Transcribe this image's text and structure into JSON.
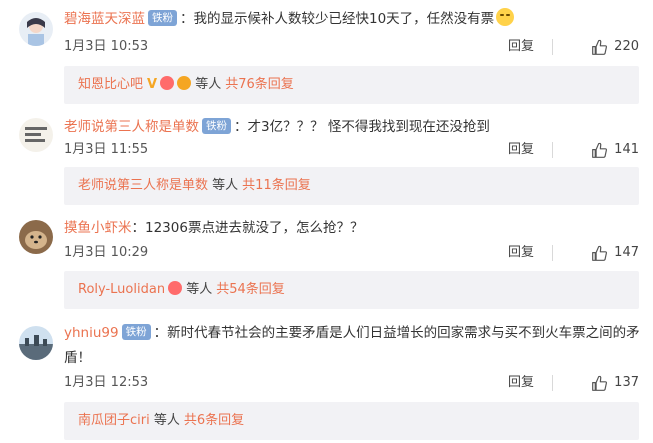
{
  "comments": [
    {
      "username": "碧海蓝天深蓝",
      "badge": "铁粉",
      "text": "：我的显示候补人数较少已经快10天了，任然没有票",
      "date": "1月3日 10:53",
      "reply_label": "回复",
      "likes": "220",
      "replies": {
        "name": "知恩比心吧",
        "middle": "等人",
        "total": "共76条回复"
      }
    },
    {
      "username": "老师说第三人称是单数",
      "badge": "铁粉",
      "text": "：才3亿？？？ 怪不得我找到现在还没抢到",
      "date": "1月3日 11:55",
      "reply_label": "回复",
      "likes": "141",
      "replies": {
        "name": "老师说第三人称是单数",
        "middle": "等人",
        "total": "共11条回复"
      }
    },
    {
      "username": "摸鱼小虾米",
      "text": "：12306票点进去就没了，怎么抢？？",
      "date": "1月3日 10:29",
      "reply_label": "回复",
      "likes": "147",
      "replies": {
        "name": "Roly-Luolidan",
        "middle": "等人",
        "total": "共54条回复"
      }
    },
    {
      "username": "yhniu99",
      "badge": "铁粉",
      "text_line1": "：新时代春节社会的主要矛盾是人们日益增长的回家需求与买不到火车票之间的矛",
      "text_line2": "盾！",
      "date": "1月3日 12:53",
      "reply_label": "回复",
      "likes": "137",
      "replies": {
        "name": "南瓜团子ciri",
        "middle": "等人",
        "total": "共6条回复"
      }
    }
  ],
  "colors": {
    "username": "#eb7350",
    "badge": "#7ea4d6",
    "reply_bg": "#f2f2f5"
  },
  "icons": [
    "thumbs-up-icon",
    "emoji-icon"
  ]
}
